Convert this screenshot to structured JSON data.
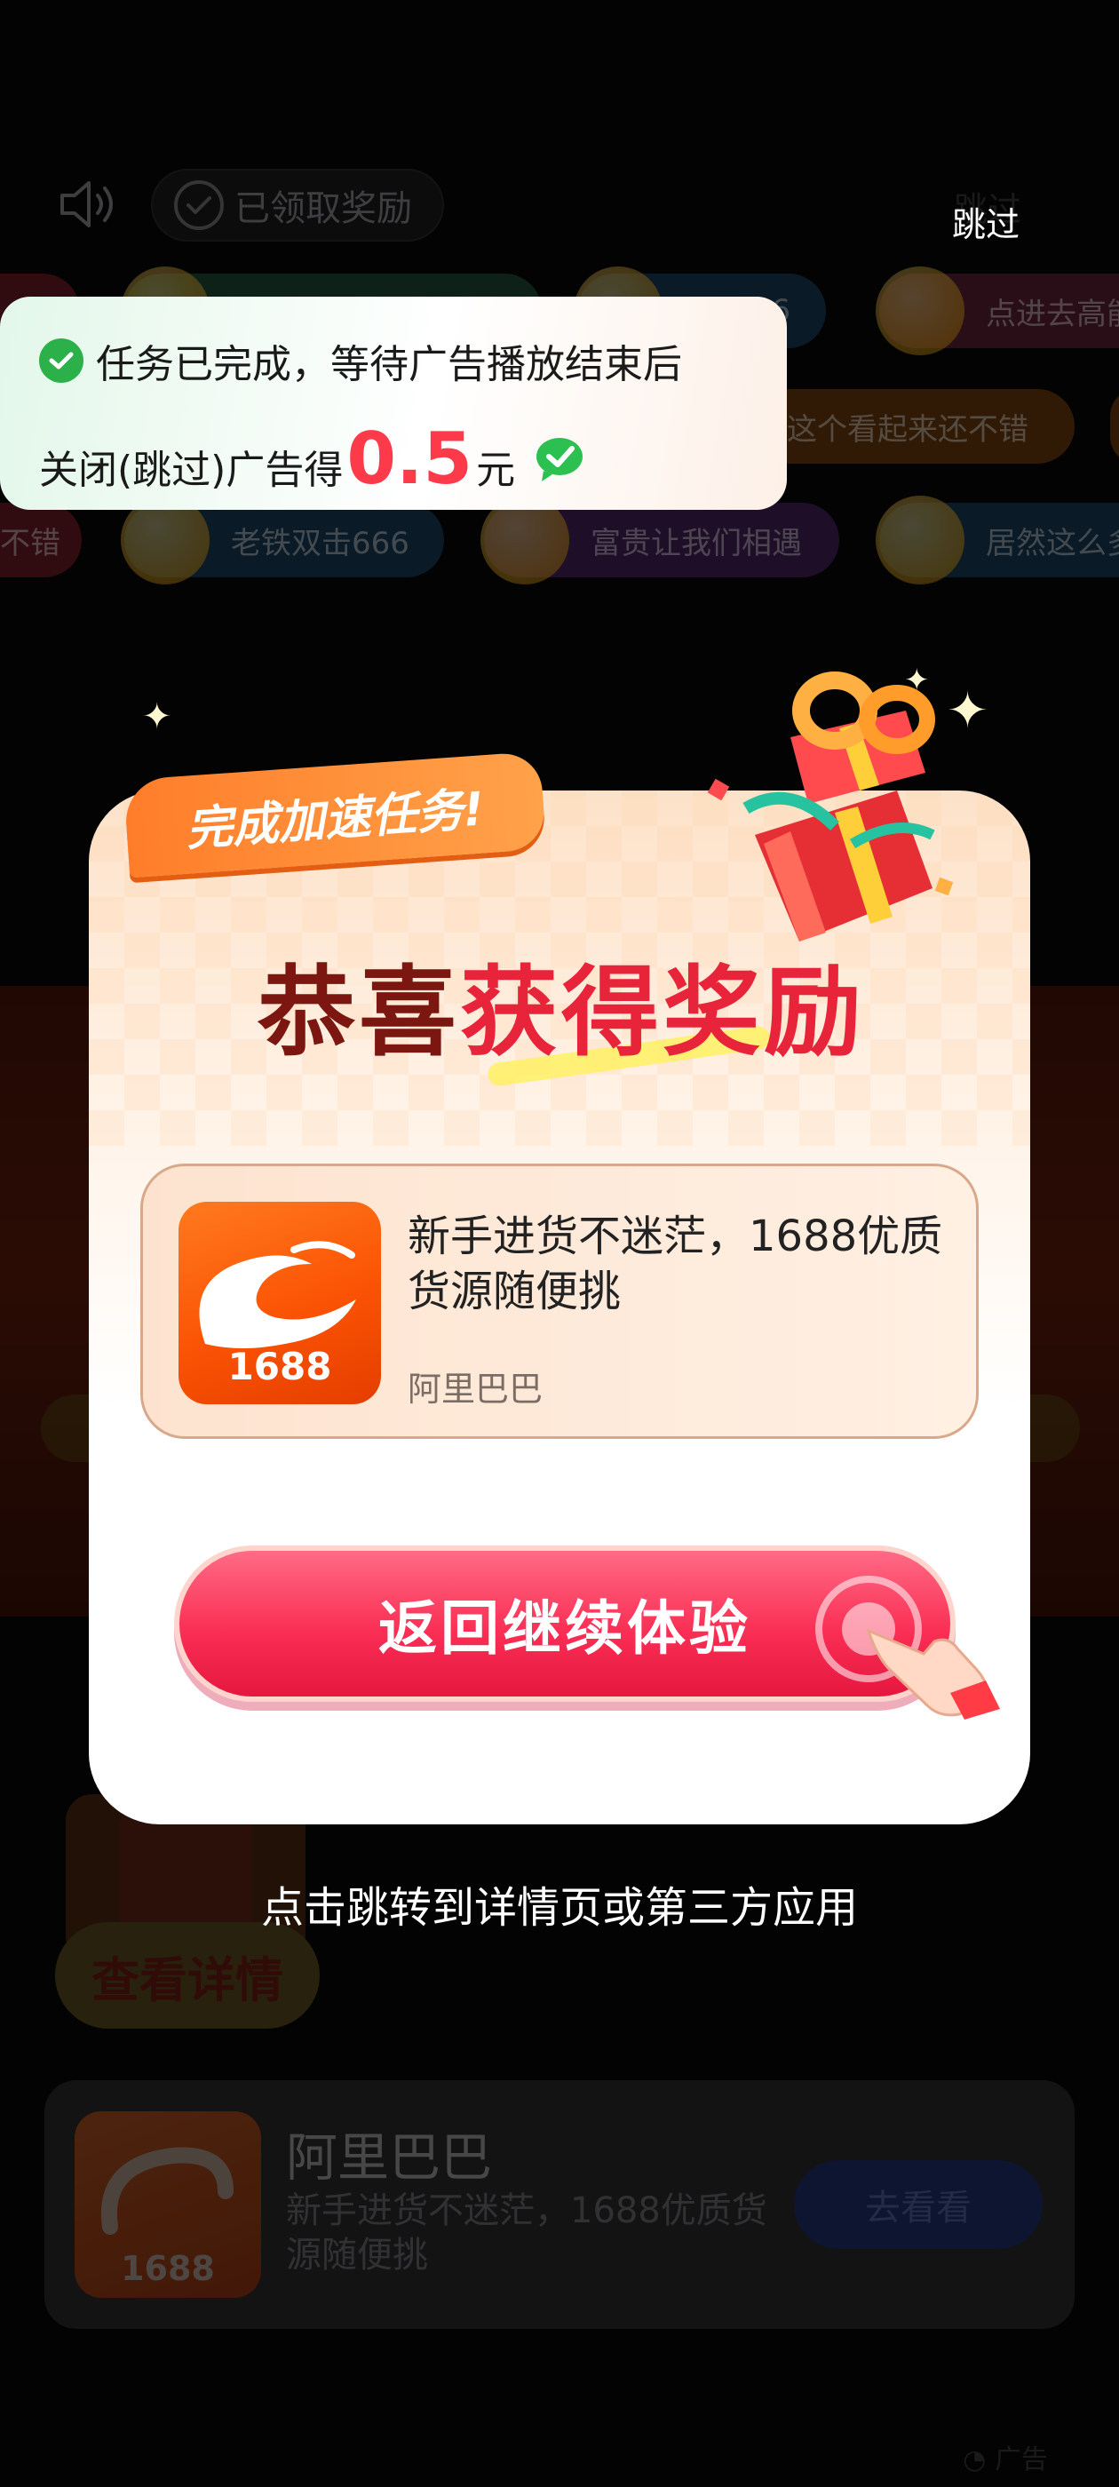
{
  "top_bar": {
    "claimed_label": "已领取奖励",
    "skip_label": "跳过"
  },
  "toast": {
    "line1": "任务已完成，等待广告播放结束后",
    "line2_prefix": "关闭(跳过)广告得",
    "amount": "0.5",
    "unit": "元"
  },
  "danmu": {
    "row1": [
      "",
      "",
      "6",
      "点进去高能"
    ],
    "row2": [
      "这个看起来还不错"
    ],
    "row3": [
      "不错",
      "老铁双击666",
      "富贵让我们相遇",
      "居然这么多"
    ]
  },
  "modal": {
    "ribbon": "完成加速任务!",
    "congrats_part1": "恭喜",
    "congrats_part2": "获得奖励",
    "card": {
      "title": "新手进货不迷茫，1688优质货源随便挑",
      "publisher": "阿里巴巴",
      "logo_number": "1688"
    },
    "cta_label": "返回继续体验"
  },
  "hint": "点击跳转到详情页或第三方应用",
  "background": {
    "detail_button": "查看详情",
    "app_name": "阿里巴巴",
    "app_desc": "新手进货不迷茫，1688优质货源随便挑",
    "go_button": "去看看",
    "logo_number": "1688",
    "ad_label": "广告"
  },
  "colors": {
    "accent_red": "#fa2f55",
    "amount_red": "#fd3a49",
    "check_green": "#2bb04a",
    "brand_orange": "#fb5304"
  }
}
